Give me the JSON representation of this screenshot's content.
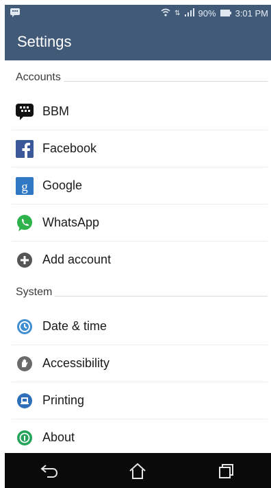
{
  "status_bar": {
    "battery_percent": "90%",
    "time": "3:01 PM",
    "icons": [
      "message-icon",
      "wifi-icon",
      "signal-icon",
      "battery-icon"
    ]
  },
  "app_bar": {
    "title": "Settings"
  },
  "sections": {
    "accounts": {
      "header": "Accounts",
      "items": [
        {
          "label": "BBM",
          "icon": "bbm-icon"
        },
        {
          "label": "Facebook",
          "icon": "facebook-icon"
        },
        {
          "label": "Google",
          "icon": "google-icon"
        },
        {
          "label": "WhatsApp",
          "icon": "whatsapp-icon"
        },
        {
          "label": "Add account",
          "icon": "add-icon"
        }
      ]
    },
    "system": {
      "header": "System",
      "items": [
        {
          "label": "Date & time",
          "icon": "clock-icon"
        },
        {
          "label": "Accessibility",
          "icon": "hand-icon"
        },
        {
          "label": "Printing",
          "icon": "printer-icon"
        },
        {
          "label": "About",
          "icon": "info-icon"
        }
      ]
    }
  },
  "nav_bar": {
    "buttons": [
      "back-icon",
      "home-icon",
      "recents-icon"
    ]
  },
  "colors": {
    "app_bar": "#415a78",
    "nav_bar": "#0a0a0a",
    "facebook": "#3b5998",
    "google": "#2f78c4",
    "whatsapp": "#2fb24b"
  }
}
